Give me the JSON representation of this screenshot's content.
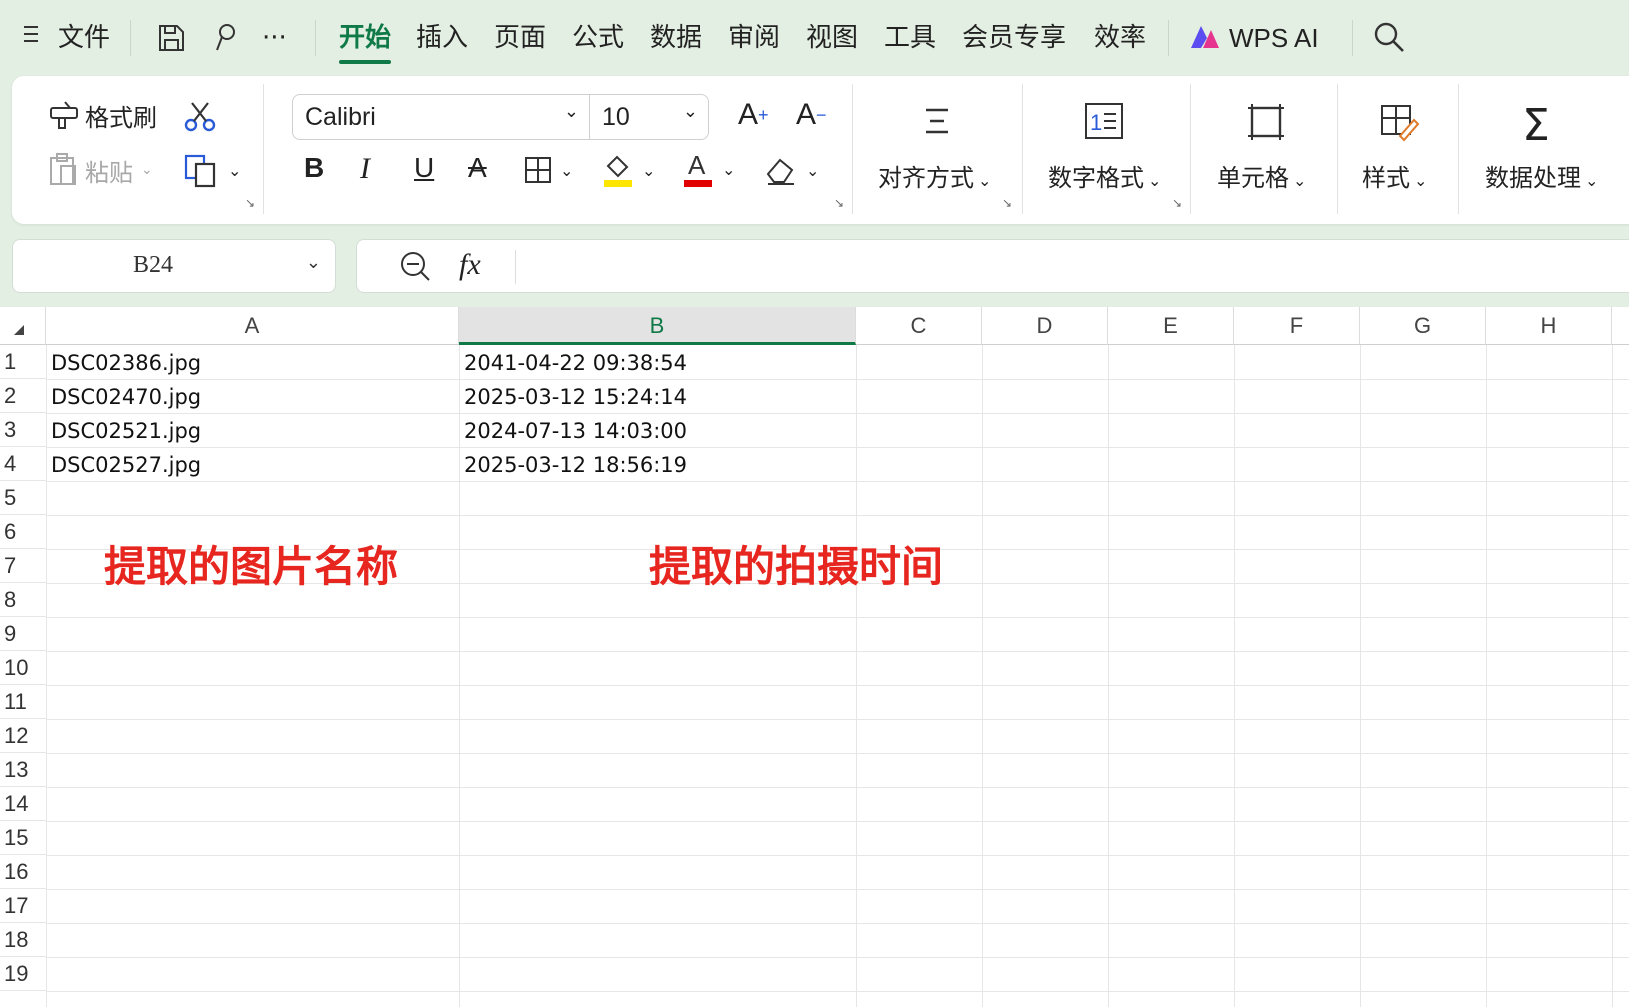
{
  "menubar": {
    "file": "文件",
    "more": "···",
    "tabs": [
      "开始",
      "插入",
      "页面",
      "公式",
      "数据",
      "审阅",
      "视图",
      "工具",
      "会员专享",
      "效率"
    ],
    "active_tab": "开始",
    "wps_ai": "WPS AI"
  },
  "ribbon": {
    "format_painter": "格式刷",
    "paste": "粘贴",
    "font_name": "Calibri",
    "font_size": "10",
    "align": "对齐方式",
    "number_format": "数字格式",
    "cell": "单元格",
    "style": "样式",
    "data_process": "数据处理",
    "fill_color": "#ffe600",
    "font_color": "#e00000"
  },
  "formula": {
    "cell_ref": "B24",
    "fx": "fx"
  },
  "grid": {
    "columns": [
      "A",
      "B",
      "C",
      "D",
      "E",
      "F",
      "G",
      "H"
    ],
    "selected_column": "B",
    "rows": [
      "1",
      "2",
      "3",
      "4",
      "5",
      "6",
      "7",
      "8",
      "9",
      "10",
      "11",
      "12",
      "13",
      "14",
      "15",
      "16",
      "17",
      "18",
      "19"
    ],
    "cells": [
      [
        "DSC02386.jpg",
        "2041-04-22 09:38:54"
      ],
      [
        "DSC02470.jpg",
        "2025-03-12 15:24:14"
      ],
      [
        "DSC02521.jpg",
        "2024-07-13 14:03:00"
      ],
      [
        "DSC02527.jpg",
        "2025-03-12 18:56:19"
      ]
    ]
  },
  "annotations": {
    "left": "提取的图片名称",
    "right": "提取的拍摄时间",
    "color": "#e6261f"
  }
}
